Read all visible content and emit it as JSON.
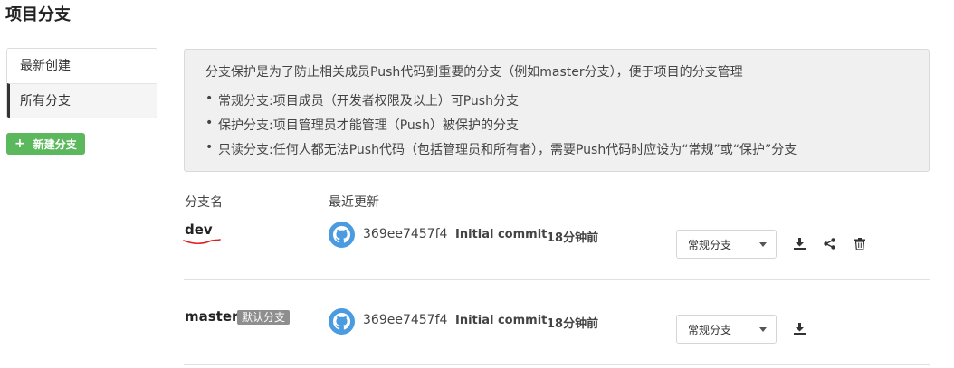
{
  "page": {
    "title": "项目分支"
  },
  "sidebar": {
    "items": [
      {
        "label": "最新创建",
        "active": false
      },
      {
        "label": "所有分支",
        "active": true
      }
    ],
    "new_branch_label": "新建分支"
  },
  "info": {
    "intro": "分支保护是为了防止相关成员Push代码到重要的分支（例如master分支），便于项目的分支管理",
    "bullets": [
      "常规分支:项目成员（开发者权限及以上）可Push分支",
      "保护分支:项目管理员才能管理（Push）被保护的分支",
      "只读分支:任何人都无法Push代码（包括管理员和所有者），需要Push代码时应设为“常规”或“保护”分支"
    ]
  },
  "table": {
    "columns": {
      "name": "分支名",
      "updated": "最近更新"
    },
    "rows": [
      {
        "name": "dev",
        "badge": "",
        "avatar_icon": "github-icon",
        "commit_hash": "369ee7457f4",
        "commit_message": "Initial commit",
        "time": "18分钟前",
        "type": "常规分支",
        "actions": [
          "download-icon",
          "share-icon",
          "trash-icon"
        ]
      },
      {
        "name": "master",
        "badge": "默认分支",
        "avatar_icon": "github-icon",
        "commit_hash": "369ee7457f4",
        "commit_message": "Initial commit",
        "time": "18分钟前",
        "type": "常规分支",
        "actions": [
          "download-icon"
        ]
      }
    ]
  },
  "colors": {
    "accent_green": "#5cb85c",
    "avatar_blue": "#4a9be0",
    "annotation_red": "#e02020"
  }
}
